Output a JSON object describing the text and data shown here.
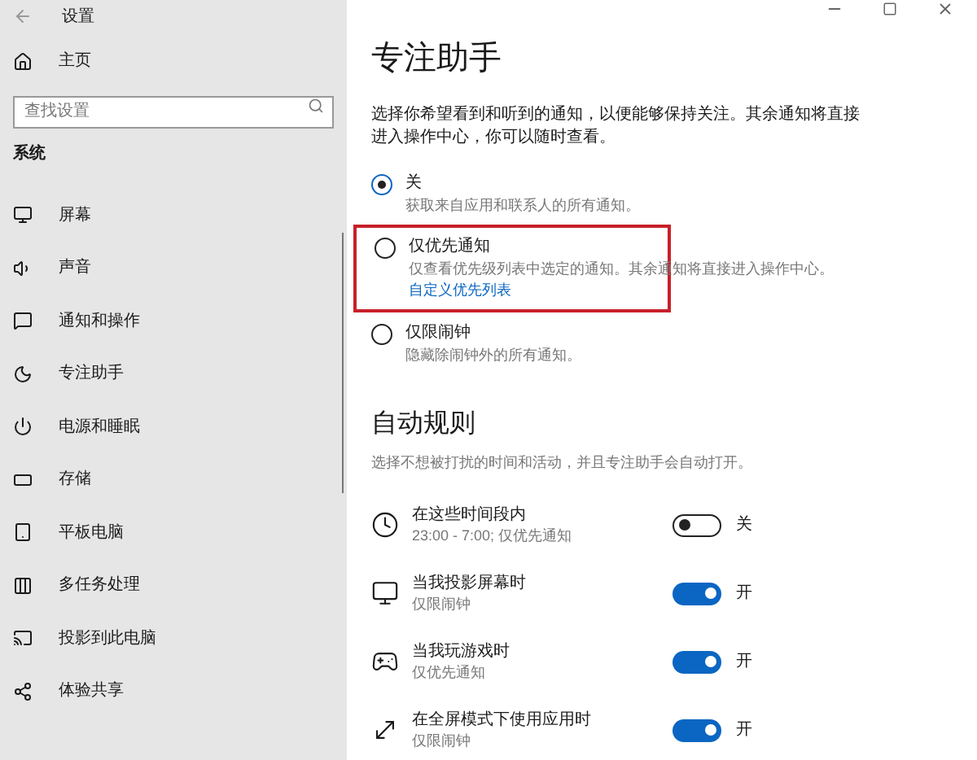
{
  "window": {
    "title": "设置"
  },
  "sidebar": {
    "home": "主页",
    "search": {
      "placeholder": "查找设置"
    },
    "section": "系统",
    "items": [
      "屏幕",
      "声音",
      "通知和操作",
      "专注助手",
      "电源和睡眠",
      "存储",
      "平板电脑",
      "多任务处理",
      "投影到此电脑",
      "体验共享"
    ]
  },
  "page": {
    "title": "专注助手",
    "description": "选择你希望看到和听到的通知，以便能够保持关注。其余通知将直接进入操作中心，你可以随时查看。",
    "options": [
      {
        "label": "关",
        "detail": "获取来自应用和联系人的所有通知。",
        "selected": true,
        "highlighted": false
      },
      {
        "label": "仅优先通知",
        "detail": "仅查看优先级列表中选定的通知。其余通知将直接进入操作中心。",
        "link": "自定义优先列表",
        "selected": false,
        "highlighted": true
      },
      {
        "label": "仅限闹钟",
        "detail": "隐藏除闹钟外的所有通知。",
        "selected": false,
        "highlighted": false
      }
    ],
    "rules_title": "自动规则",
    "rules_description": "选择不想被打扰的时间和活动，并且专注助手会自动打开。",
    "rules": [
      {
        "title": "在这些时间段内",
        "detail": "23:00 - 7:00; 仅优先通知",
        "on": false,
        "state": "关"
      },
      {
        "title": "当我投影屏幕时",
        "detail": "仅限闹钟",
        "on": true,
        "state": "开"
      },
      {
        "title": "当我玩游戏时",
        "detail": "仅优先通知",
        "on": true,
        "state": "开"
      },
      {
        "title": "在全屏模式下使用应用时",
        "detail": "仅限闹钟",
        "on": true,
        "state": "开"
      }
    ]
  }
}
